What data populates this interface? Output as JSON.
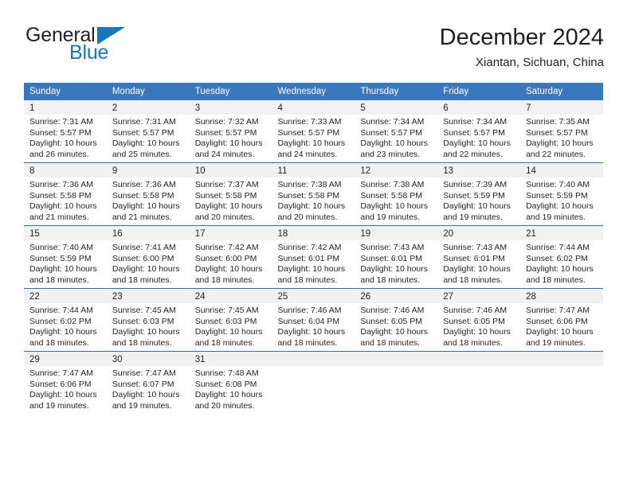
{
  "brand": {
    "word_one": "General",
    "word_two": "Blue",
    "triangle_icon": "triangle-logo-icon",
    "accent_color": "#1b75bb"
  },
  "header": {
    "title": "December 2024",
    "subtitle": "Xiantan, Sichuan, China"
  },
  "theme": {
    "header_blue": "#3b77bc",
    "row_divider_blue": "#2f6cb0",
    "daynum_band_gray": "#f1f1f1",
    "text_color": "#231f20"
  },
  "weekday_headers": [
    "Sunday",
    "Monday",
    "Tuesday",
    "Wednesday",
    "Thursday",
    "Friday",
    "Saturday"
  ],
  "labels": {
    "sunrise_prefix": "Sunrise:",
    "sunset_prefix": "Sunset:",
    "daylight_prefix": "Daylight:"
  },
  "weeks": [
    [
      {
        "day": "1",
        "sunrise": "Sunrise: 7:31 AM",
        "sunset": "Sunset: 5:57 PM",
        "daylight_line1": "Daylight: 10 hours",
        "daylight_line2": "and 26 minutes."
      },
      {
        "day": "2",
        "sunrise": "Sunrise: 7:31 AM",
        "sunset": "Sunset: 5:57 PM",
        "daylight_line1": "Daylight: 10 hours",
        "daylight_line2": "and 25 minutes."
      },
      {
        "day": "3",
        "sunrise": "Sunrise: 7:32 AM",
        "sunset": "Sunset: 5:57 PM",
        "daylight_line1": "Daylight: 10 hours",
        "daylight_line2": "and 24 minutes."
      },
      {
        "day": "4",
        "sunrise": "Sunrise: 7:33 AM",
        "sunset": "Sunset: 5:57 PM",
        "daylight_line1": "Daylight: 10 hours",
        "daylight_line2": "and 24 minutes."
      },
      {
        "day": "5",
        "sunrise": "Sunrise: 7:34 AM",
        "sunset": "Sunset: 5:57 PM",
        "daylight_line1": "Daylight: 10 hours",
        "daylight_line2": "and 23 minutes."
      },
      {
        "day": "6",
        "sunrise": "Sunrise: 7:34 AM",
        "sunset": "Sunset: 5:57 PM",
        "daylight_line1": "Daylight: 10 hours",
        "daylight_line2": "and 22 minutes."
      },
      {
        "day": "7",
        "sunrise": "Sunrise: 7:35 AM",
        "sunset": "Sunset: 5:57 PM",
        "daylight_line1": "Daylight: 10 hours",
        "daylight_line2": "and 22 minutes."
      }
    ],
    [
      {
        "day": "8",
        "sunrise": "Sunrise: 7:36 AM",
        "sunset": "Sunset: 5:58 PM",
        "daylight_line1": "Daylight: 10 hours",
        "daylight_line2": "and 21 minutes."
      },
      {
        "day": "9",
        "sunrise": "Sunrise: 7:36 AM",
        "sunset": "Sunset: 5:58 PM",
        "daylight_line1": "Daylight: 10 hours",
        "daylight_line2": "and 21 minutes."
      },
      {
        "day": "10",
        "sunrise": "Sunrise: 7:37 AM",
        "sunset": "Sunset: 5:58 PM",
        "daylight_line1": "Daylight: 10 hours",
        "daylight_line2": "and 20 minutes."
      },
      {
        "day": "11",
        "sunrise": "Sunrise: 7:38 AM",
        "sunset": "Sunset: 5:58 PM",
        "daylight_line1": "Daylight: 10 hours",
        "daylight_line2": "and 20 minutes."
      },
      {
        "day": "12",
        "sunrise": "Sunrise: 7:38 AM",
        "sunset": "Sunset: 5:58 PM",
        "daylight_line1": "Daylight: 10 hours",
        "daylight_line2": "and 19 minutes."
      },
      {
        "day": "13",
        "sunrise": "Sunrise: 7:39 AM",
        "sunset": "Sunset: 5:59 PM",
        "daylight_line1": "Daylight: 10 hours",
        "daylight_line2": "and 19 minutes."
      },
      {
        "day": "14",
        "sunrise": "Sunrise: 7:40 AM",
        "sunset": "Sunset: 5:59 PM",
        "daylight_line1": "Daylight: 10 hours",
        "daylight_line2": "and 19 minutes."
      }
    ],
    [
      {
        "day": "15",
        "sunrise": "Sunrise: 7:40 AM",
        "sunset": "Sunset: 5:59 PM",
        "daylight_line1": "Daylight: 10 hours",
        "daylight_line2": "and 18 minutes."
      },
      {
        "day": "16",
        "sunrise": "Sunrise: 7:41 AM",
        "sunset": "Sunset: 6:00 PM",
        "daylight_line1": "Daylight: 10 hours",
        "daylight_line2": "and 18 minutes."
      },
      {
        "day": "17",
        "sunrise": "Sunrise: 7:42 AM",
        "sunset": "Sunset: 6:00 PM",
        "daylight_line1": "Daylight: 10 hours",
        "daylight_line2": "and 18 minutes."
      },
      {
        "day": "18",
        "sunrise": "Sunrise: 7:42 AM",
        "sunset": "Sunset: 6:01 PM",
        "daylight_line1": "Daylight: 10 hours",
        "daylight_line2": "and 18 minutes."
      },
      {
        "day": "19",
        "sunrise": "Sunrise: 7:43 AM",
        "sunset": "Sunset: 6:01 PM",
        "daylight_line1": "Daylight: 10 hours",
        "daylight_line2": "and 18 minutes."
      },
      {
        "day": "20",
        "sunrise": "Sunrise: 7:43 AM",
        "sunset": "Sunset: 6:01 PM",
        "daylight_line1": "Daylight: 10 hours",
        "daylight_line2": "and 18 minutes."
      },
      {
        "day": "21",
        "sunrise": "Sunrise: 7:44 AM",
        "sunset": "Sunset: 6:02 PM",
        "daylight_line1": "Daylight: 10 hours",
        "daylight_line2": "and 18 minutes."
      }
    ],
    [
      {
        "day": "22",
        "sunrise": "Sunrise: 7:44 AM",
        "sunset": "Sunset: 6:02 PM",
        "daylight_line1": "Daylight: 10 hours",
        "daylight_line2": "and 18 minutes."
      },
      {
        "day": "23",
        "sunrise": "Sunrise: 7:45 AM",
        "sunset": "Sunset: 6:03 PM",
        "daylight_line1": "Daylight: 10 hours",
        "daylight_line2": "and 18 minutes."
      },
      {
        "day": "24",
        "sunrise": "Sunrise: 7:45 AM",
        "sunset": "Sunset: 6:03 PM",
        "daylight_line1": "Daylight: 10 hours",
        "daylight_line2": "and 18 minutes."
      },
      {
        "day": "25",
        "sunrise": "Sunrise: 7:46 AM",
        "sunset": "Sunset: 6:04 PM",
        "daylight_line1": "Daylight: 10 hours",
        "daylight_line2": "and 18 minutes."
      },
      {
        "day": "26",
        "sunrise": "Sunrise: 7:46 AM",
        "sunset": "Sunset: 6:05 PM",
        "daylight_line1": "Daylight: 10 hours",
        "daylight_line2": "and 18 minutes."
      },
      {
        "day": "27",
        "sunrise": "Sunrise: 7:46 AM",
        "sunset": "Sunset: 6:05 PM",
        "daylight_line1": "Daylight: 10 hours",
        "daylight_line2": "and 18 minutes."
      },
      {
        "day": "28",
        "sunrise": "Sunrise: 7:47 AM",
        "sunset": "Sunset: 6:06 PM",
        "daylight_line1": "Daylight: 10 hours",
        "daylight_line2": "and 19 minutes."
      }
    ],
    [
      {
        "day": "29",
        "sunrise": "Sunrise: 7:47 AM",
        "sunset": "Sunset: 6:06 PM",
        "daylight_line1": "Daylight: 10 hours",
        "daylight_line2": "and 19 minutes."
      },
      {
        "day": "30",
        "sunrise": "Sunrise: 7:47 AM",
        "sunset": "Sunset: 6:07 PM",
        "daylight_line1": "Daylight: 10 hours",
        "daylight_line2": "and 19 minutes."
      },
      {
        "day": "31",
        "sunrise": "Sunrise: 7:48 AM",
        "sunset": "Sunset: 6:08 PM",
        "daylight_line1": "Daylight: 10 hours",
        "daylight_line2": "and 20 minutes."
      },
      {
        "day": "",
        "sunrise": "",
        "sunset": "",
        "daylight_line1": "",
        "daylight_line2": ""
      },
      {
        "day": "",
        "sunrise": "",
        "sunset": "",
        "daylight_line1": "",
        "daylight_line2": ""
      },
      {
        "day": "",
        "sunrise": "",
        "sunset": "",
        "daylight_line1": "",
        "daylight_line2": ""
      },
      {
        "day": "",
        "sunrise": "",
        "sunset": "",
        "daylight_line1": "",
        "daylight_line2": ""
      }
    ]
  ]
}
